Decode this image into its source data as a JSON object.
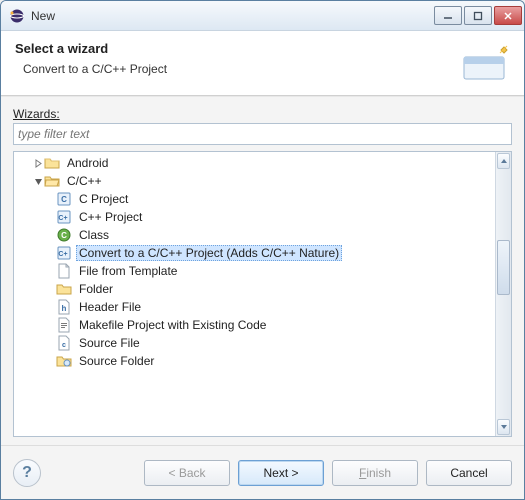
{
  "window": {
    "title": "New"
  },
  "header": {
    "title": "Select a wizard",
    "subtitle": "Convert to a C/C++ Project"
  },
  "body": {
    "wizards_label": "Wizards:",
    "filter_placeholder": "type filter text"
  },
  "tree": {
    "android": "Android",
    "cpp": "C/C++",
    "items": [
      "C Project",
      "C++ Project",
      "Class",
      "Convert to a C/C++ Project (Adds C/C++ Nature)",
      "File from Template",
      "Folder",
      "Header File",
      "Makefile Project with Existing Code",
      "Source File",
      "Source Folder"
    ],
    "selected_index": 3
  },
  "buttons": {
    "back": "< Back",
    "next": "Next >",
    "finish": "Finish",
    "cancel": "Cancel"
  }
}
